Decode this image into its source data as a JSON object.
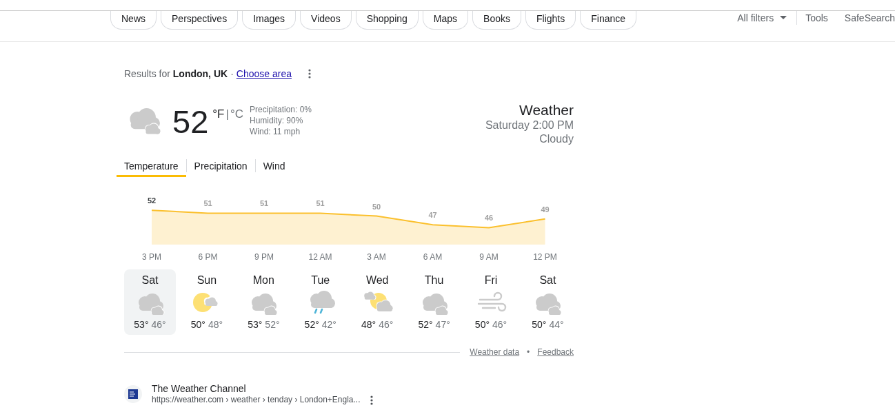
{
  "search_tabs": [
    {
      "label": "News",
      "selected": false
    },
    {
      "label": "Perspectives",
      "selected": false
    },
    {
      "label": "Images",
      "selected": false
    },
    {
      "label": "Videos",
      "selected": false
    },
    {
      "label": "Shopping",
      "selected": false
    },
    {
      "label": "Maps",
      "selected": false
    },
    {
      "label": "Books",
      "selected": false
    },
    {
      "label": "Flights",
      "selected": false
    },
    {
      "label": "Finance",
      "selected": false
    }
  ],
  "tools": {
    "all_filters": "All filters",
    "tools": "Tools",
    "safesearch": "SafeSearch"
  },
  "location": {
    "prefix": "Results for",
    "place": "London, UK",
    "separator": "·",
    "link": "Choose area"
  },
  "current": {
    "temperature": "52",
    "units": [
      {
        "label": "°F",
        "selected": true
      },
      {
        "label": "°C",
        "selected": false
      }
    ],
    "unit_sep": "|",
    "details": [
      "Precipitation: 0%",
      "Humidity: 90%",
      "Wind: 11 mph"
    ],
    "title": "Weather",
    "time": "Saturday 2:00 PM",
    "condition": "Cloudy"
  },
  "chart_tabs": [
    {
      "label": "Temperature",
      "selected": true
    },
    {
      "label": "Precipitation",
      "selected": false
    },
    {
      "label": "Wind",
      "selected": false
    }
  ],
  "chart_data": {
    "type": "area",
    "categories": [
      "3 PM",
      "6 PM",
      "9 PM",
      "12 AM",
      "3 AM",
      "6 AM",
      "9 AM",
      "12 PM"
    ],
    "series": [
      {
        "color": "#fbc02d",
        "values": [
          52,
          51,
          51,
          51,
          50,
          47,
          46,
          49
        ]
      }
    ],
    "data_labels": true
  },
  "days": [
    {
      "day": "Sat",
      "kind": "cloudy",
      "high": "53°",
      "low": "46°",
      "selected": true
    },
    {
      "day": "Sun",
      "kind": "sunny-cloud",
      "high": "50°",
      "low": "48°",
      "selected": false
    },
    {
      "day": "Mon",
      "kind": "cloudy",
      "high": "53°",
      "low": "52°",
      "selected": false
    },
    {
      "day": "Tue",
      "kind": "rain",
      "high": "52°",
      "low": "42°",
      "selected": false
    },
    {
      "day": "Wed",
      "kind": "partly-cloudy",
      "high": "48°",
      "low": "46°",
      "selected": false
    },
    {
      "day": "Thu",
      "kind": "cloudy",
      "high": "52°",
      "low": "47°",
      "selected": false
    },
    {
      "day": "Fri",
      "kind": "wind",
      "high": "50°",
      "low": "46°",
      "selected": false
    },
    {
      "day": "Sat",
      "kind": "cloudy",
      "high": "50°",
      "low": "44°",
      "selected": false
    }
  ],
  "footer": {
    "data_link": "Weather data",
    "dot": "•",
    "feedback": "Feedback"
  },
  "result": {
    "title": "The Weather Channel",
    "url": "https://weather.com › weather › tenday › London+Engla..."
  }
}
